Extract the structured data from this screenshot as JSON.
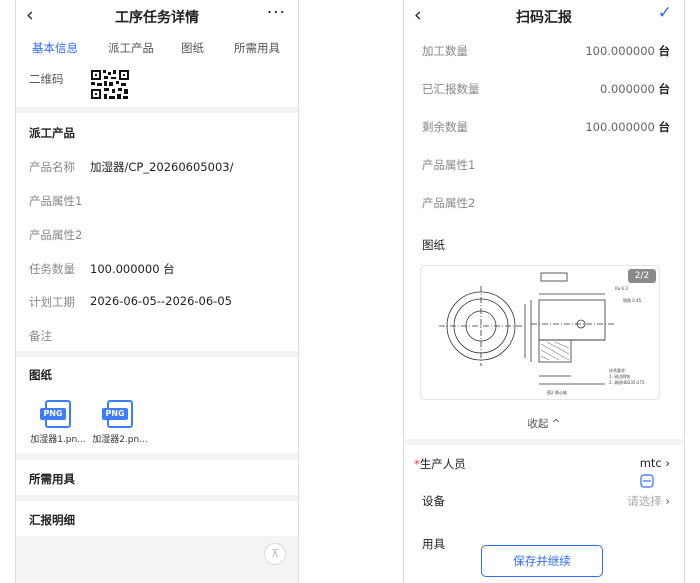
{
  "left": {
    "back": "‹",
    "title": "工序任务详情",
    "more": "···",
    "tabs": [
      "基本信息",
      "派工产品",
      "图纸",
      "所需用具"
    ],
    "qrcode_label": "二维码",
    "product_section": "派工产品",
    "fields": [
      {
        "label": "产品名称",
        "value": "加湿器/CP_20260605003/"
      },
      {
        "label": "产品属性1",
        "value": ""
      },
      {
        "label": "产品属性2",
        "value": ""
      },
      {
        "label": "任务数量",
        "value": "100.000000 台"
      },
      {
        "label": "计划工期",
        "value": "2026-06-05--2026-06-05"
      },
      {
        "label": "备注",
        "value": ""
      }
    ],
    "drawing_section": "图纸",
    "files": [
      {
        "ext": "PNG",
        "name": "加湿器1.pn..."
      },
      {
        "ext": "PNG",
        "name": "加湿器2.pn..."
      }
    ],
    "tools_section": "所需用具",
    "report_section": "汇报明细",
    "totop_icon": "⊼"
  },
  "right": {
    "back": "‹",
    "title": "扫码汇报",
    "confirm": "✓",
    "rows": [
      {
        "label": "加工数量",
        "value": "100.000000",
        "unit": "台"
      },
      {
        "label": "已汇报数量",
        "value": "0.000000",
        "unit": "台"
      },
      {
        "label": "剩余数量",
        "value": "100.000000",
        "unit": "台"
      },
      {
        "label": "产品属性1",
        "value": "",
        "unit": ""
      },
      {
        "label": "产品属性2",
        "value": "",
        "unit": ""
      }
    ],
    "drawing_label": "图纸",
    "drawing_page": "2/2",
    "collapse_label": "收起 ^",
    "form": [
      {
        "label": "生产人员",
        "value": "mtc",
        "required": "*"
      },
      {
        "label": "设备",
        "value": "请选择"
      },
      {
        "label": "用具",
        "value": ""
      }
    ],
    "chevron": "›",
    "save_button": "保存并继续"
  },
  "colors": {
    "accent": "#2f6bff",
    "background": "#f3f4f6",
    "required": "#e53935"
  }
}
